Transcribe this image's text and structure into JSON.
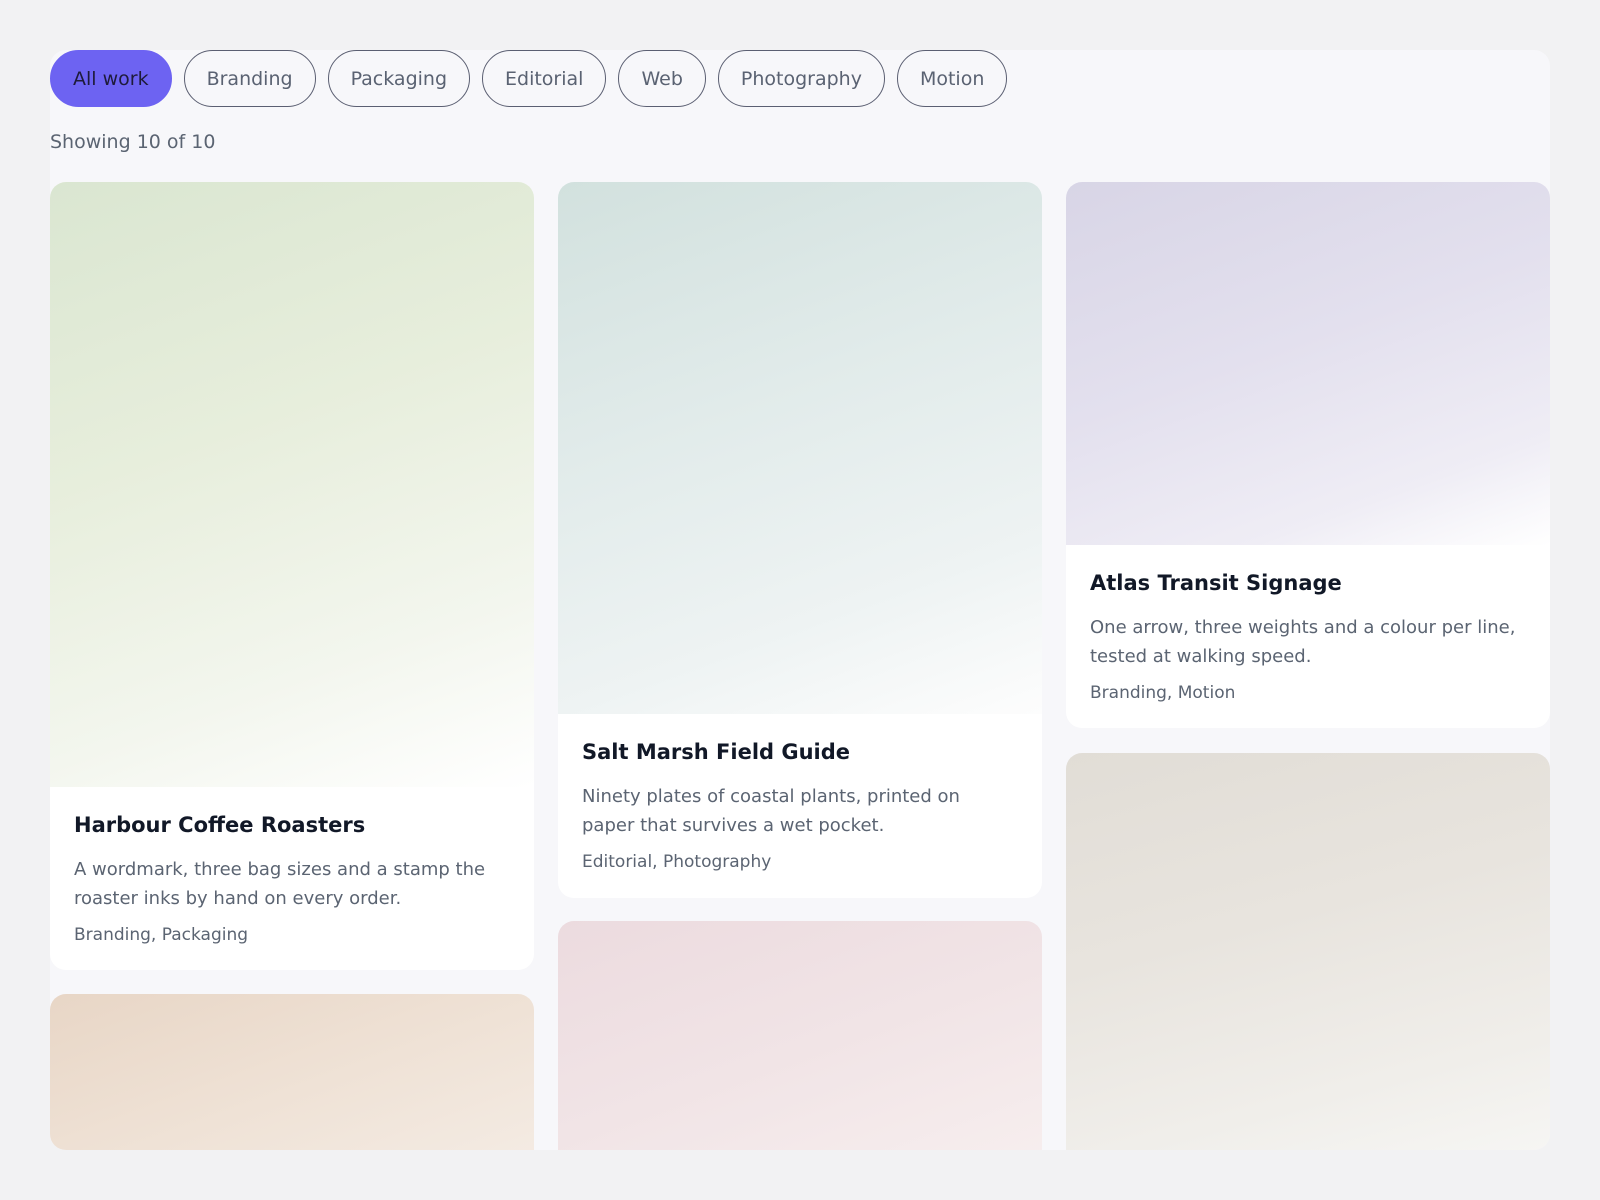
{
  "filters": {
    "items": [
      {
        "label": "All work",
        "active": true
      },
      {
        "label": "Branding",
        "active": false
      },
      {
        "label": "Packaging",
        "active": false
      },
      {
        "label": "Editorial",
        "active": false
      },
      {
        "label": "Web",
        "active": false
      },
      {
        "label": "Photography",
        "active": false
      },
      {
        "label": "Motion",
        "active": false
      }
    ],
    "active_color": "#6d63f2"
  },
  "results": {
    "count_text": "Showing 10 of 10"
  },
  "cards": [
    {
      "title": "Harbour Coffee Roasters",
      "description": "A wordmark, three bag sizes and a stamp the roaster inks by hand on every order.",
      "tags": "Branding, Packaging",
      "thumb_color": "#dde6d2"
    },
    {
      "title": "Salt Marsh Field Guide",
      "description": "Ninety plates of coastal plants, printed on paper that survives a wet pocket.",
      "tags": "Editorial, Photography",
      "thumb_color": "#d4e2e0"
    },
    {
      "title": "Atlas Transit Signage",
      "description": "One arrow, three weights and a colour per line, tested at walking speed.",
      "tags": "Branding, Motion",
      "thumb_color": "#dad7e8"
    },
    {
      "thumb_color": "#e9d9cb"
    },
    {
      "thumb_color": "#eedcdf"
    },
    {
      "thumb_color": "#e3ded6"
    }
  ]
}
